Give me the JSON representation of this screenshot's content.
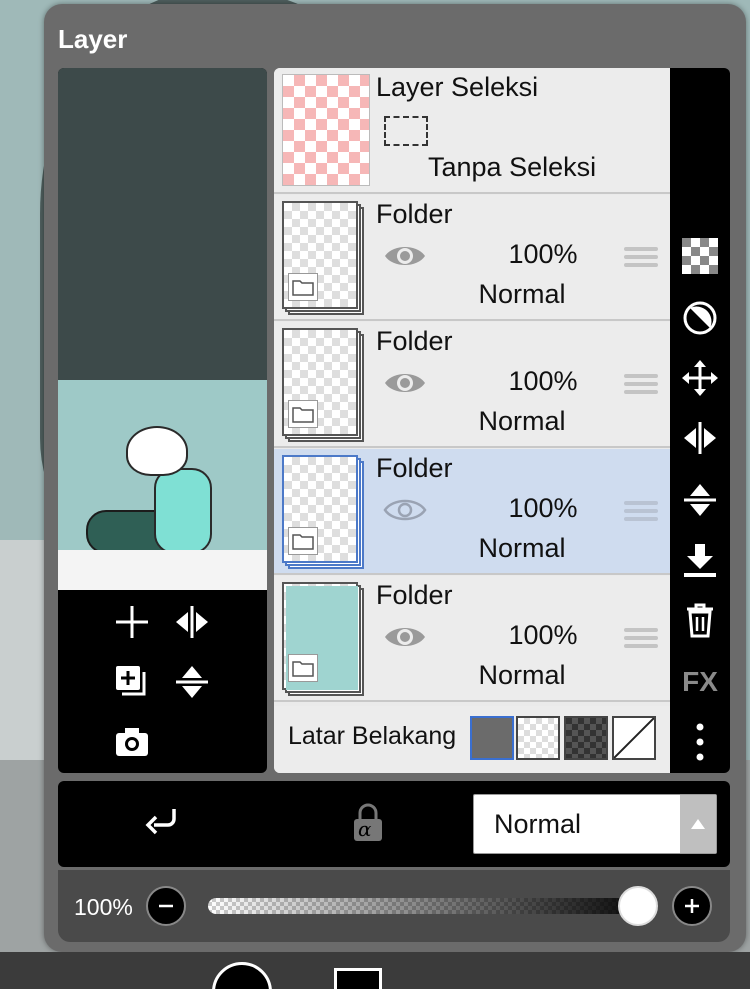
{
  "panel": {
    "title": "Layer"
  },
  "selection_layer": {
    "name": "Layer Seleksi",
    "status": "Tanpa Seleksi"
  },
  "layers": [
    {
      "name": "Folder",
      "opacity": "100%",
      "blend": "Normal",
      "visible": true,
      "selected": false
    },
    {
      "name": "Folder",
      "opacity": "100%",
      "blend": "Normal",
      "visible": true,
      "selected": false
    },
    {
      "name": "Folder",
      "opacity": "100%",
      "blend": "Normal",
      "visible": false,
      "selected": true
    },
    {
      "name": "Folder",
      "opacity": "100%",
      "blend": "Normal",
      "visible": true,
      "selected": false
    }
  ],
  "background": {
    "label": "Latar Belakang",
    "options": [
      "gray",
      "white-checker",
      "dark-checker",
      "none"
    ],
    "selected": "gray"
  },
  "toolbar": {
    "items": [
      "checker-icon",
      "contrast-icon",
      "move-icon",
      "flip-horizontal-icon",
      "flip-vertical-icon",
      "merge-down-icon",
      "trash-icon",
      "fx-icon",
      "more-icon"
    ],
    "fx_label": "FX"
  },
  "preview_tools": [
    "add-layer-icon",
    "flip-horizontal-icon",
    "duplicate-layer-icon",
    "flip-vertical-icon",
    "camera-icon"
  ],
  "bottom_bar": {
    "blend_mode": "Normal",
    "lock_symbol": "α"
  },
  "opacity_slider": {
    "label": "100%",
    "value": 1.0
  },
  "colors": {
    "panel": "#6b6b6b",
    "selected_row": "#cfdcef",
    "accent": "#3a6fd0"
  }
}
